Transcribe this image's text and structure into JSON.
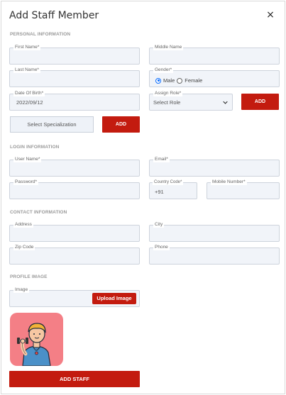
{
  "modal": {
    "title": "Add Staff Member",
    "close_glyph": "×"
  },
  "sections": {
    "personal": "PERSONAL INFORMATION",
    "login": "LOGIN INFORMATION",
    "contact": "CONTACT INFORMATION",
    "profile": "PROFILE IMAGE"
  },
  "personal": {
    "first_name": {
      "label": "First Name*",
      "value": ""
    },
    "middle_name": {
      "label": "Middle Name",
      "value": ""
    },
    "last_name": {
      "label": "Last Name*",
      "value": ""
    },
    "gender": {
      "label": "Gender*",
      "options": [
        "Male",
        "Female"
      ],
      "selected": "Male"
    },
    "dob": {
      "label": "Date Of Birth*",
      "value": "2022/09/12"
    },
    "assign_role": {
      "label": "Assign Role*",
      "value": "Select Role"
    },
    "add_role_label": "ADD",
    "select_specialization_label": "Select Specialization",
    "add_specialization_label": "ADD"
  },
  "login": {
    "user_name": {
      "label": "User Name*",
      "value": ""
    },
    "email": {
      "label": "Email*",
      "value": ""
    },
    "password": {
      "label": "Password*",
      "value": ""
    },
    "country_code": {
      "label": "Country Code*",
      "value": "+91"
    },
    "mobile": {
      "label": "Mobile Number*",
      "value": ""
    }
  },
  "contact": {
    "address": {
      "label": "Address",
      "value": ""
    },
    "city": {
      "label": "City",
      "value": ""
    },
    "zip": {
      "label": "Zip Code",
      "value": ""
    },
    "phone": {
      "label": "Phone",
      "value": ""
    }
  },
  "profile": {
    "image": {
      "label": "Image"
    },
    "upload_label": "Upload Image"
  },
  "submit_label": "ADD STAFF",
  "colors": {
    "accent": "#c31b0f",
    "field_bg": "#f1f4f9",
    "avatar_bg": "#f47f86"
  }
}
